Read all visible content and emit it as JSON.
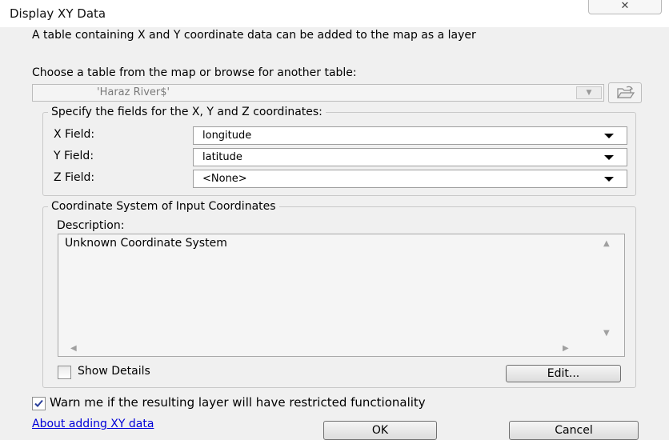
{
  "window": {
    "title": "Display XY Data",
    "close_glyph": "✕"
  },
  "intro": {
    "text": "A table containing X and Y coordinate data can be added to the map as a layer"
  },
  "table_chooser": {
    "label": "Choose a table from the map or browse for another table:",
    "value": "'Haraz River$'"
  },
  "fields_group": {
    "legend": "Specify the fields for the X, Y and Z coordinates:",
    "x_label": "X Field:",
    "x_value": "longitude",
    "y_label": "Y Field:",
    "y_value": "latitude",
    "z_label": "Z Field:",
    "z_value": "<None>"
  },
  "coord_group": {
    "legend": "Coordinate System of Input Coordinates",
    "description_label": "Description:",
    "description_text": "Unknown Coordinate System",
    "show_details_label": "Show Details",
    "show_details_checked": false,
    "edit_button": "Edit..."
  },
  "warn": {
    "label": "Warn me if the resulting layer will have restricted functionality",
    "checked": true
  },
  "footer": {
    "help_link": "About adding XY data",
    "ok_button": "OK",
    "cancel_button": "Cancel"
  }
}
